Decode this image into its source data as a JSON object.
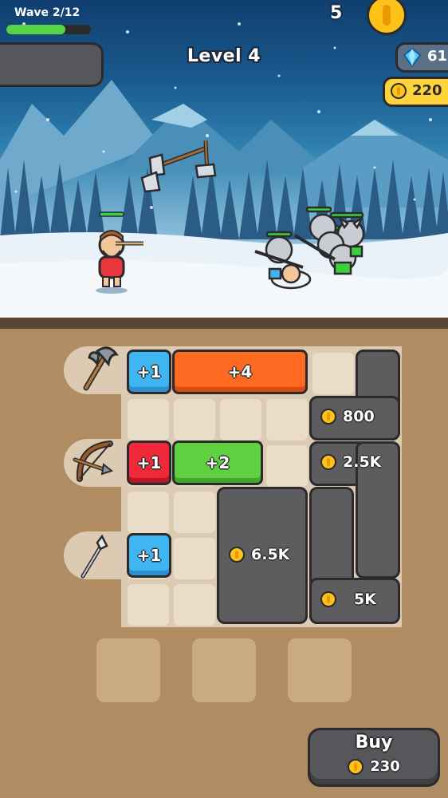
{
  "hud": {
    "wave_label": "Wave 2/12",
    "wave_progress": 0.7,
    "level_title": "Level 4",
    "top_count": "5",
    "gems": "61",
    "gold": "220"
  },
  "weapons": [
    {
      "name": "axe-icon"
    },
    {
      "name": "crossbow-icon"
    },
    {
      "name": "spear-icon"
    }
  ],
  "tiles": {
    "axe_plus1": "+1",
    "axe_plus4": "+4",
    "crossbow_plus1": "+1",
    "crossbow_plus2": "+2",
    "spear_plus1": "+1"
  },
  "locked_slots": {
    "price_800": "800",
    "price_2_5k": "2.5K",
    "price_6_5k": "6.5K",
    "price_5k": "5K"
  },
  "buy": {
    "label": "Buy",
    "price": "230"
  },
  "colors": {
    "blue_tile": "#3fb6f2",
    "orange_tile": "#ff6a22",
    "red_tile": "#f0283a",
    "green_tile": "#5fd03f",
    "locked": "#5d5d60",
    "gold": "#ffc21a"
  }
}
